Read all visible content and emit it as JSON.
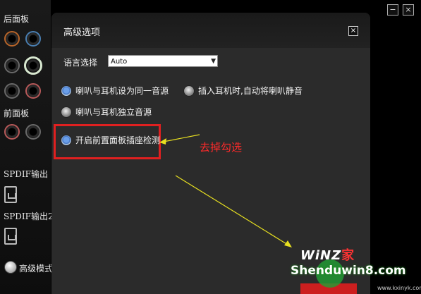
{
  "left_panel": {
    "rear_panel_label": "后面板",
    "front_panel_label": "前面板",
    "spdif_out_label": "SPDIF输出",
    "spdif_out2_label": "SPDIF输出2",
    "advanced_mode_label": "高级模式"
  },
  "window_controls": {
    "minimize": "−",
    "close": "×"
  },
  "dialog": {
    "title": "高级选项",
    "close": "×",
    "language_label": "语言选择",
    "language_value": "Auto",
    "options": [
      {
        "label": "喇叭与耳机设为同一音源",
        "selected": true
      },
      {
        "label": "插入耳机时,自动将喇叭静音",
        "selected": false
      },
      {
        "label": "喇叭与耳机独立音源",
        "selected": false
      },
      {
        "label": "开启前置面板插座检测",
        "selected": true
      }
    ]
  },
  "annotation": {
    "text": "去掉勾选",
    "color": "#ff2a2a"
  },
  "watermark": {
    "line1": "WiNZ",
    "line1_accent": "家",
    "line2": "Shenduwin8.com",
    "line3": "www.kxinyk.com"
  },
  "colors": {
    "highlight": "#e02020",
    "arrow": "#e8e020",
    "dialog_bg": "#2b2b2b"
  }
}
